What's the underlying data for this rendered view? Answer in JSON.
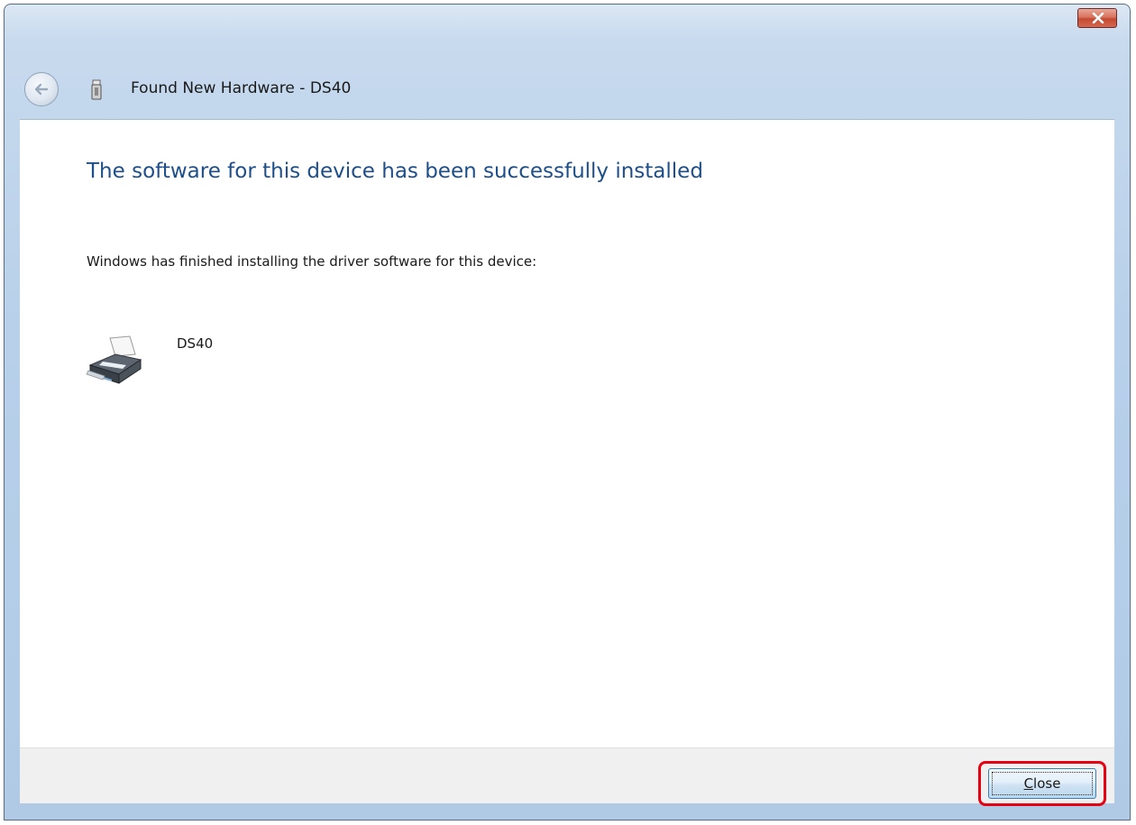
{
  "window": {
    "title": "Found New Hardware - DS40"
  },
  "content": {
    "heading": "The software for this device has been successfully installed",
    "message": "Windows has finished installing the driver software for this device:",
    "device_name": "DS40"
  },
  "footer": {
    "close_button": {
      "mnemonic": "C",
      "rest": "lose"
    }
  },
  "icons": {
    "back": "back-arrow-icon",
    "usb": "usb-device-icon",
    "close_window": "close-icon",
    "device": "printer-icon"
  },
  "colors": {
    "heading": "#1e4f8a",
    "highlight": "#e60012",
    "titlebar": "#b8d0ea"
  }
}
